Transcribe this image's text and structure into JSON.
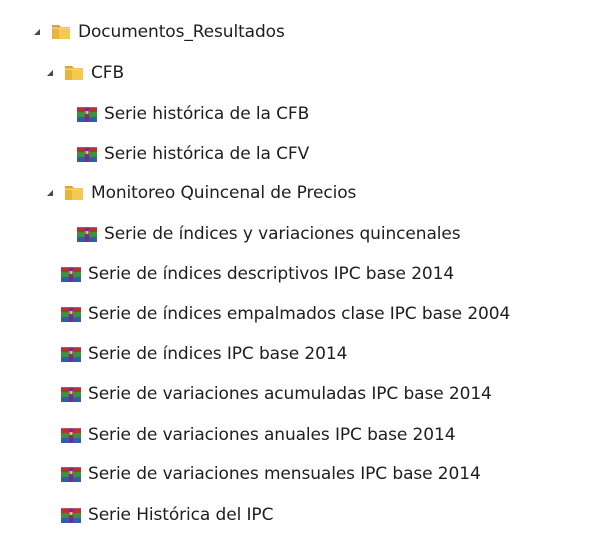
{
  "tree": {
    "root": {
      "label": "Documentos_Resultados",
      "expanded": true,
      "icon": "folder-icon"
    },
    "cfb": {
      "label": "CFB",
      "expanded": true,
      "icon": "folder-icon",
      "items": [
        {
          "label": "Serie histórica de la CFB",
          "icon": "rar-archive-icon"
        },
        {
          "label": "Serie histórica de la CFV",
          "icon": "rar-archive-icon"
        }
      ]
    },
    "monitoreo": {
      "label": "Monitoreo Quincenal de Precios",
      "expanded": true,
      "icon": "folder-icon",
      "items": [
        {
          "label": "Serie de índices y variaciones quincenales",
          "icon": "rar-archive-icon"
        }
      ]
    },
    "files": [
      {
        "label": "Serie de índices descriptivos IPC base 2014",
        "icon": "rar-archive-icon"
      },
      {
        "label": "Serie de índices empalmados clase IPC base 2004",
        "icon": "rar-archive-icon"
      },
      {
        "label": "Serie de índices IPC base 2014",
        "icon": "rar-archive-icon"
      },
      {
        "label": "Serie de variaciones acumuladas IPC base 2014",
        "icon": "rar-archive-icon"
      },
      {
        "label": "Serie de variaciones anuales IPC base 2014",
        "icon": "rar-archive-icon"
      },
      {
        "label": "Serie de variaciones mensuales IPC base 2014",
        "icon": "rar-archive-icon"
      },
      {
        "label": "Serie Histórica del IPC",
        "icon": "rar-archive-icon"
      }
    ]
  },
  "colors": {
    "expander": "#4a4a4a",
    "folder_front": "#f2c44e",
    "folder_back": "#dca631",
    "rar_red": "#b8303a",
    "rar_blue": "#2f5fa8",
    "rar_green": "#3f8f3c"
  }
}
